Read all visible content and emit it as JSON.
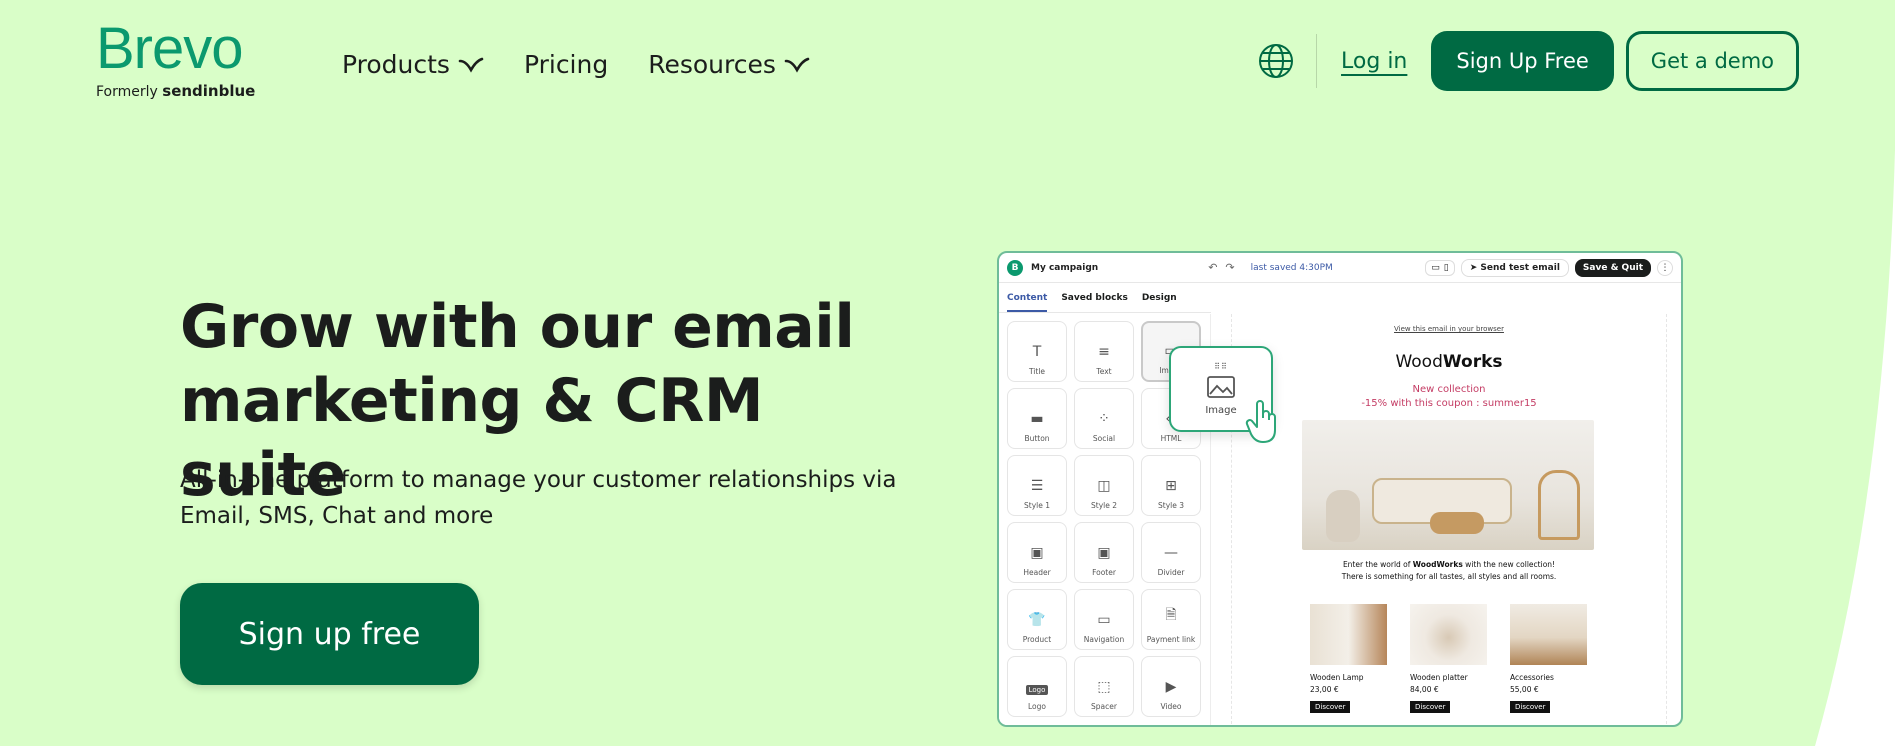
{
  "header": {
    "logo_text": "Brevo",
    "formerly_label": "Formerly",
    "formerly_brand": "sendinblue",
    "nav": [
      {
        "label": "Products"
      },
      {
        "label": "Pricing"
      },
      {
        "label": "Resources"
      }
    ],
    "login_label": "Log in",
    "signup_label": "Sign Up Free",
    "demo_label": "Get a demo",
    "globe_icon": "globe-icon"
  },
  "hero": {
    "title": "Grow with our email marketing & CRM suite",
    "subtitle": "All-in-one platform to manage your customer relationships via Email, SMS, Chat and more",
    "cta_label": "Sign up free"
  },
  "editor": {
    "campaign_name": "My campaign",
    "saved_text": "last saved 4:30PM",
    "send_test_label": "Send test email",
    "save_quit_label": "Save & Quit",
    "tabs": [
      {
        "label": "Content"
      },
      {
        "label": "Saved blocks"
      },
      {
        "label": "Design"
      }
    ],
    "blocks": [
      {
        "label": "Title",
        "icon": "T"
      },
      {
        "label": "Text",
        "icon": "≡"
      },
      {
        "label": "Image",
        "icon": "▭"
      },
      {
        "label": "Button",
        "icon": "▬"
      },
      {
        "label": "Social",
        "icon": "⁘"
      },
      {
        "label": "HTML",
        "icon": "‹›"
      },
      {
        "label": "Style 1",
        "icon": "☰"
      },
      {
        "label": "Style 2",
        "icon": "◫"
      },
      {
        "label": "Style 3",
        "icon": "⊞"
      },
      {
        "label": "Header",
        "icon": "▣"
      },
      {
        "label": "Footer",
        "icon": "▣"
      },
      {
        "label": "Divider",
        "icon": "—"
      },
      {
        "label": "Product",
        "icon": "👕"
      },
      {
        "label": "Navigation",
        "icon": "▭"
      },
      {
        "label": "Payment link",
        "icon": "🗎"
      },
      {
        "label": "Logo",
        "icon": "Logo"
      },
      {
        "label": "Spacer",
        "icon": "⬚"
      },
      {
        "label": "Video",
        "icon": "▶"
      }
    ],
    "drag_label": "Image",
    "email": {
      "view_link": "View this email in your browser",
      "brand_regular": "Wood",
      "brand_bold": "Works",
      "promo_line1": "New collection",
      "promo_line2": "-15% with this coupon : summer15",
      "caption_pre": "Enter the world of ",
      "caption_bold": "WoodWorks",
      "caption_post": " with the new collection!",
      "caption_line2": "There is something for all tastes, all styles and all rooms.",
      "products": [
        {
          "name": "Wooden Lamp",
          "price": "23,00 €",
          "button": "Discover"
        },
        {
          "name": "Wooden platter",
          "price": "84,00 €",
          "button": "Discover"
        },
        {
          "name": "Accessories",
          "price": "55,00 €",
          "button": "Discover"
        }
      ]
    }
  },
  "colors": {
    "background": "#d9fec8",
    "brand_green": "#006a43",
    "logo_green": "#0b996e",
    "promo_pink": "#c43c64"
  }
}
